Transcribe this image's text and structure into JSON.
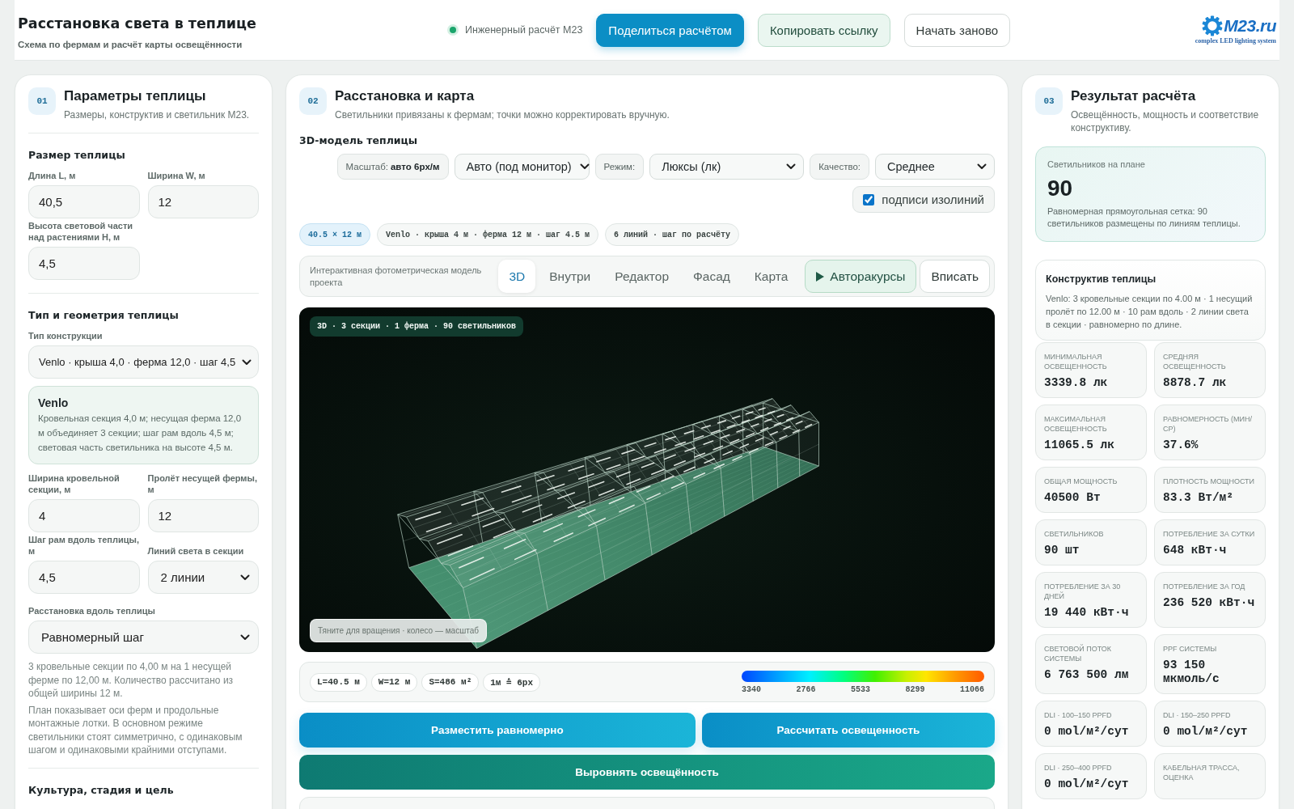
{
  "header": {
    "title": "Расстановка света в теплице",
    "subtitle": "Схема по фермам и расчёт карты освещённости",
    "status": "Инженерный расчёт M23",
    "buttons": [
      {
        "label": "Поделиться расчётом",
        "kind": "primary"
      },
      {
        "label": "Копировать ссылку",
        "kind": "soft"
      },
      {
        "label": "Начать заново",
        "kind": "plain"
      }
    ],
    "logo": {
      "name": "M23.ru",
      "tagline": "complex LED lighting system"
    }
  },
  "params_panel": {
    "number": "01",
    "title": "Параметры теплицы",
    "subtitle": "Размеры, конструктив и светильник M23.",
    "size_section": {
      "title": "Размер теплицы",
      "fields": [
        {
          "label": "Длина L, м",
          "kind": "input",
          "value": "40,5"
        },
        {
          "label": "Ширина W, м",
          "kind": "input",
          "value": "12"
        },
        {
          "label": "Высота световой части над растениями H, м",
          "kind": "input",
          "value": "4,5"
        }
      ]
    },
    "type_section": {
      "title": "Тип и геометрия теплицы",
      "construction": {
        "label": "Тип конструкции",
        "value": "Venlo · крыша 4,0 · ферма 12,0 · шаг 4,5"
      },
      "info": {
        "title": "Venlo",
        "text": "Кровельная секция 4,0 м; несущая ферма 12,0 м объединяет 3 секции; шаг рам вдоль 4,5 м; световая часть светильника на высоте 4,5 м."
      },
      "fields": [
        {
          "label": "Ширина кровельной секции, м",
          "kind": "input",
          "value": "4"
        },
        {
          "label": "Пролёт несущей фермы, м",
          "kind": "input",
          "value": "12"
        },
        {
          "label": "Шаг рам вдоль теплицы, м",
          "kind": "input",
          "value": "4,5"
        },
        {
          "label": "Линий света в секции",
          "kind": "select",
          "value": "2 линии"
        }
      ],
      "placement": {
        "label": "Расстановка вдоль теплицы",
        "value": "Равномерный шаг"
      },
      "notes": [
        "3 кровельные секции по 4,00 м на 1 несущей ферме по 12,00 м. Количество рассчитано из общей ширины 12 м.",
        "План показывает оси ферм и продольные монтажные лотки. В основном режиме светильники стоят симметрично, с одинаковым шагом и одинаковыми крайними отступами."
      ]
    },
    "crop_section": {
      "title": "Культура, стадия и цель"
    }
  },
  "layout_panel": {
    "number": "02",
    "title": "Расстановка и карта",
    "subtitle": "Светильники привязаны к фермам; точки можно корректировать вручную.",
    "model_title": "3D-модель теплицы",
    "controls": [
      {
        "kind": "tag",
        "text": "Масштаб: **авто 6px/м**"
      },
      {
        "kind": "select",
        "text": "Авто (под монитор)"
      },
      {
        "kind": "tag",
        "text": "Режим:"
      },
      {
        "kind": "select",
        "text": "Люксы (лк)"
      },
      {
        "kind": "tag",
        "text": "Качество:"
      },
      {
        "kind": "select",
        "text": "Среднее"
      },
      {
        "kind": "checkbox",
        "text": "подписи изолиний",
        "checked": true
      }
    ],
    "chips": [
      {
        "text": "40.5 × 12 м",
        "kind": "accent"
      },
      {
        "text": "Venlo · крыша 4 м · ферма 12 м · шаг 4.5 м",
        "kind": "plain"
      },
      {
        "text": "6 линий · шаг по расчёту",
        "kind": "plain"
      }
    ],
    "view_bar": {
      "caption": "Интерактивная фотометрическая модель проекта",
      "tabs": [
        {
          "label": "3D",
          "selected": true
        },
        {
          "label": "Внутри",
          "selected": false
        },
        {
          "label": "Редактор",
          "selected": false
        },
        {
          "label": "Фасад",
          "selected": false
        },
        {
          "label": "Карта",
          "selected": false
        }
      ],
      "buttons": [
        {
          "label": "Авторакурсы",
          "kind": "play"
        },
        {
          "label": "Вписать",
          "kind": "plain"
        }
      ]
    },
    "viewport": {
      "badge": "3D · 3 секции · 1 ферма · 90 светильников",
      "hint": "Тяните для вращения · колесо — масштаб"
    },
    "legend": {
      "chips": [
        "L=40.5 м",
        "W=12 м",
        "S=486 м²",
        "1м ≙ 6px"
      ],
      "scale": [
        "3340",
        "2766",
        "5533",
        "8299",
        "11066"
      ]
    },
    "actions": [
      {
        "label": "Разместить равномерно",
        "kind": "primary"
      },
      {
        "label": "Рассчитать освещенность",
        "kind": "primary"
      },
      {
        "label": "Выровнять освещённость",
        "kind": "teal"
      }
    ]
  },
  "results_panel": {
    "number": "03",
    "title": "Результат расчёта",
    "subtitle": "Освещённость, мощность и соответствие конструктиву.",
    "summary": {
      "label": "Светильников на плане",
      "value": "90",
      "text": "Равномерная прямоугольная сетка: 90 светильников размещены по линиям теплицы."
    },
    "construction": {
      "title": "Конструктив теплицы",
      "text": "Venlo: 3 кровельные секции по 4.00 м · 1 несущий пролёт по 12.00 м · 10 рам вдоль · 2 линии света в секции · равномерно по длине."
    },
    "metrics": [
      {
        "label": "МИНИМАЛЬНАЯ ОСВЕЩЕННОСТЬ",
        "value": "3339.8 лк"
      },
      {
        "label": "СРЕДНЯЯ ОСВЕЩЕННОСТЬ",
        "value": "8878.7 лк"
      },
      {
        "label": "МАКСИМАЛЬНАЯ ОСВЕЩЕННОСТЬ",
        "value": "11065.5 лк"
      },
      {
        "label": "РАВНОМЕРНОСТЬ (МИН/СР)",
        "value": "37.6%"
      },
      {
        "label": "ОБЩАЯ МОЩНОСТЬ",
        "value": "40500 Вт"
      },
      {
        "label": "ПЛОТНОСТЬ МОЩНОСТИ",
        "value": "83.3 Вт/м²"
      },
      {
        "label": "СВЕТИЛЬНИКОВ",
        "value": "90 шт"
      },
      {
        "label": "ПОТРЕБЛЕНИЕ ЗА СУТКИ",
        "value": "648 кВт·ч"
      },
      {
        "label": "ПОТРЕБЛЕНИЕ ЗА 30 ДНЕЙ",
        "value": "19 440 кВт·ч"
      },
      {
        "label": "ПОТРЕБЛЕНИЕ ЗА ГОД",
        "value": "236 520 кВт·ч"
      },
      {
        "label": "СВЕТОВОЙ ПОТОК СИСТЕМЫ",
        "value": "6 763 500 лм"
      },
      {
        "label": "PPF СИСТЕМЫ",
        "value": "93 150 мкмоль/с"
      },
      {
        "label": "DLI · 100–150 PPFD",
        "value": "0 mol/м²/сут"
      },
      {
        "label": "DLI · 150–250 PPFD",
        "value": "0 mol/м²/сут"
      },
      {
        "label": "DLI · 250–400 PPFD",
        "value": "0 mol/м²/сут"
      },
      {
        "label": "КАБЕЛЬНАЯ ТРАССА, ОЦЕНКА"
      }
    ]
  }
}
